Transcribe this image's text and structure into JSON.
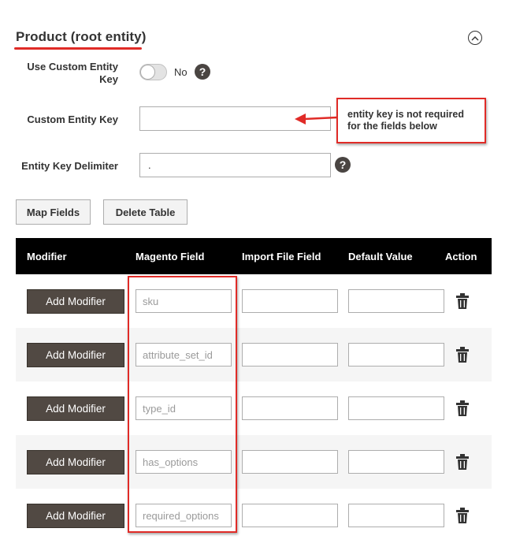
{
  "section": {
    "title": "Product (root entity)"
  },
  "form": {
    "use_custom_key": {
      "label_line1": "Use Custom Entity",
      "label_line2": "Key",
      "toggle_state": "No",
      "help": "?"
    },
    "custom_key": {
      "label": "Custom Entity Key",
      "value": ""
    },
    "delimiter": {
      "label": "Entity Key Delimiter",
      "value": ".",
      "help": "?"
    }
  },
  "annotation": {
    "line1": "entity key is not required",
    "line2": "for the fields below",
    "color": "#e02b27"
  },
  "buttons": {
    "map_fields": "Map Fields",
    "delete_table": "Delete Table"
  },
  "table": {
    "headers": {
      "modifier": "Modifier",
      "magento_field": "Magento Field",
      "import_file_field": "Import File Field",
      "default_value": "Default Value",
      "action": "Action"
    },
    "add_modifier_label": "Add Modifier",
    "action_icon": "trash-icon",
    "rows": [
      {
        "magento_field": "sku",
        "import_file_field": "",
        "default_value": ""
      },
      {
        "magento_field": "attribute_set_id",
        "import_file_field": "",
        "default_value": ""
      },
      {
        "magento_field": "type_id",
        "import_file_field": "",
        "default_value": ""
      },
      {
        "magento_field": "has_options",
        "import_file_field": "",
        "default_value": ""
      },
      {
        "magento_field": "required_options",
        "import_file_field": "",
        "default_value": ""
      }
    ]
  },
  "colors": {
    "accent_red": "#e02b27",
    "header_bg": "#000000",
    "button_dark": "#514943"
  }
}
